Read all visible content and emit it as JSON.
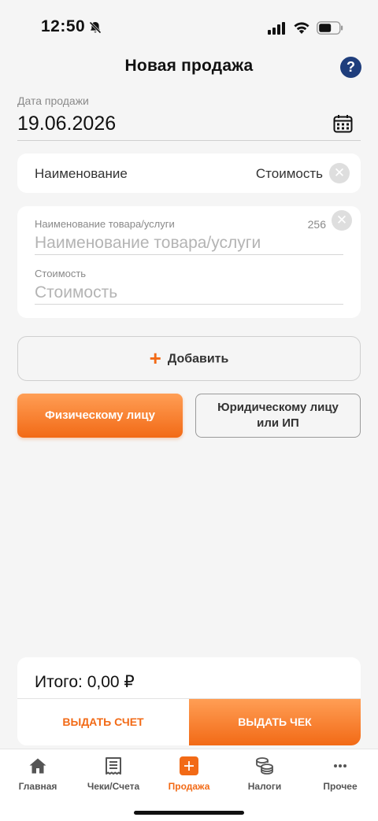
{
  "status_bar": {
    "time": "12:50"
  },
  "nav": {
    "title": "Новая продажа",
    "help_label": "?"
  },
  "date": {
    "label": "Дата продажи",
    "value": "19.06.2026"
  },
  "items_header": {
    "name_label": "Наименование",
    "cost_label": "Стоимость"
  },
  "item": {
    "name_label": "Наименование товара/услуги",
    "name_placeholder": "Наименование товара/услуги",
    "name_value": "",
    "counter": "256",
    "cost_label": "Стоимость",
    "cost_placeholder": "Стоимость",
    "cost_value": ""
  },
  "add_button": {
    "plus": "+",
    "label": "Добавить"
  },
  "buyer_type": {
    "physical": "Физическому лицу",
    "juridical": "Юридическому лицу или ИП",
    "selected": "physical"
  },
  "total": {
    "text": "Итого: 0,00 ₽",
    "invoice_button": "ВЫДАТЬ СЧЕТ",
    "receipt_button": "ВЫДАТЬ ЧЕК"
  },
  "tabs": [
    {
      "label": "Главная",
      "icon": "home-icon"
    },
    {
      "label": "Чеки/Счета",
      "icon": "receipt-icon"
    },
    {
      "label": "Продажа",
      "icon": "plus-square-icon",
      "active": true
    },
    {
      "label": "Налоги",
      "icon": "coins-icon"
    },
    {
      "label": "Прочее",
      "icon": "more-icon"
    }
  ],
  "colors": {
    "accent": "#f26a16",
    "help_badge": "#1f3e7c",
    "background": "#f5f5f5"
  }
}
